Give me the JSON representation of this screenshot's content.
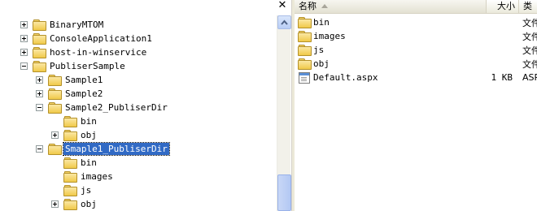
{
  "tree": {
    "close_glyph": "✕",
    "items": [
      {
        "label": "BinaryMTOM",
        "expander": "plus",
        "selected": false
      },
      {
        "label": "ConsoleApplication1",
        "expander": "plus",
        "selected": false
      },
      {
        "label": "host-in-winservice",
        "expander": "plus",
        "selected": false
      },
      {
        "label": "PubliserSample",
        "expander": "minus",
        "selected": false
      },
      {
        "label": "Sample1",
        "expander": "plus",
        "selected": false
      },
      {
        "label": "Sample2",
        "expander": "plus",
        "selected": false
      },
      {
        "label": "Sample2_PubliserDir",
        "expander": "minus",
        "selected": false
      },
      {
        "label": "bin",
        "expander": "none",
        "selected": false
      },
      {
        "label": "obj",
        "expander": "plus",
        "selected": false
      },
      {
        "label": "Smaple1_PubliserDir",
        "expander": "minus",
        "selected": true
      },
      {
        "label": "bin",
        "expander": "none",
        "selected": false
      },
      {
        "label": "images",
        "expander": "none",
        "selected": false
      },
      {
        "label": "js",
        "expander": "none",
        "selected": false
      },
      {
        "label": "obj",
        "expander": "plus",
        "selected": false
      }
    ]
  },
  "list": {
    "columns": {
      "name": "名称",
      "size": "大小",
      "type": "类"
    },
    "files": [
      {
        "name": "bin",
        "size": "",
        "type": "文件",
        "icon": "folder-icon"
      },
      {
        "name": "images",
        "size": "",
        "type": "文件",
        "icon": "folder-icon"
      },
      {
        "name": "js",
        "size": "",
        "type": "文件",
        "icon": "folder-icon"
      },
      {
        "name": "obj",
        "size": "",
        "type": "文件",
        "icon": "folder-icon"
      },
      {
        "name": "Default.aspx",
        "size": "1 KB",
        "type": "ASP",
        "icon": "aspx-file-icon"
      }
    ]
  },
  "colors": {
    "selection": "#316ac5",
    "folder": "#f0c94a",
    "header_bg": "#ebeadb"
  }
}
